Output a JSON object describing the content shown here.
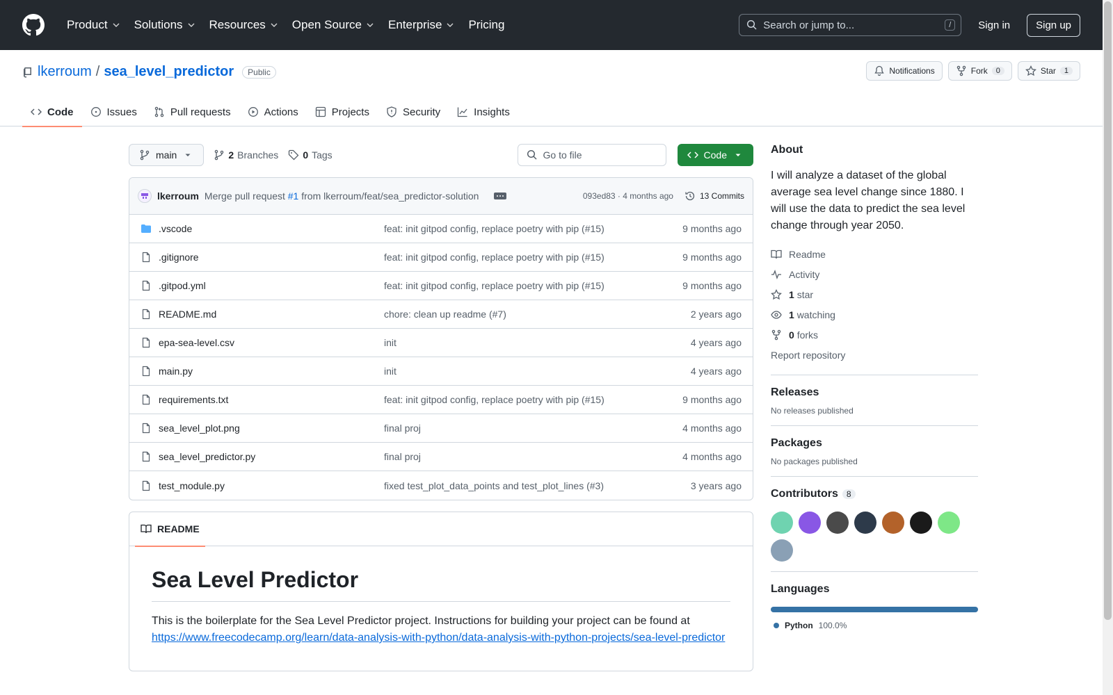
{
  "header": {
    "nav": [
      "Product",
      "Solutions",
      "Resources",
      "Open Source",
      "Enterprise",
      "Pricing"
    ],
    "search_placeholder": "Search or jump to...",
    "search_shortcut": "/",
    "sign_in": "Sign in",
    "sign_up": "Sign up"
  },
  "repo": {
    "owner": "lkerroum",
    "separator": "/",
    "name": "sea_level_predictor",
    "visibility": "Public",
    "notifications": "Notifications",
    "fork_label": "Fork",
    "fork_count": "0",
    "star_label": "Star",
    "star_count": "1",
    "tabs": [
      "Code",
      "Issues",
      "Pull requests",
      "Actions",
      "Projects",
      "Security",
      "Insights"
    ]
  },
  "toolbar": {
    "branch": "main",
    "branches_count": "2",
    "branches_label": "Branches",
    "tags_count": "0",
    "tags_label": "Tags",
    "goto_file": "Go to file",
    "code_button": "Code"
  },
  "commit": {
    "author": "lkerroum",
    "msg_prefix": "Merge pull request",
    "pr": "#1",
    "msg_suffix": "from lkerroum/feat/sea_predictor-solution",
    "hash_age": "093ed83 · 4 months ago",
    "commits_label": "13 Commits"
  },
  "files": [
    {
      "name": ".vscode",
      "type": "folder",
      "msg": "feat: init gitpod config, replace poetry with pip (#15)",
      "age": "9 months ago"
    },
    {
      "name": ".gitignore",
      "type": "file",
      "msg": "feat: init gitpod config, replace poetry with pip (#15)",
      "age": "9 months ago"
    },
    {
      "name": ".gitpod.yml",
      "type": "file",
      "msg": "feat: init gitpod config, replace poetry with pip (#15)",
      "age": "9 months ago"
    },
    {
      "name": "README.md",
      "type": "file",
      "msg": "chore: clean up readme (#7)",
      "age": "2 years ago"
    },
    {
      "name": "epa-sea-level.csv",
      "type": "file",
      "msg": "init",
      "age": "4 years ago"
    },
    {
      "name": "main.py",
      "type": "file",
      "msg": "init",
      "age": "4 years ago"
    },
    {
      "name": "requirements.txt",
      "type": "file",
      "msg": "feat: init gitpod config, replace poetry with pip (#15)",
      "age": "9 months ago"
    },
    {
      "name": "sea_level_plot.png",
      "type": "file",
      "msg": "final proj",
      "age": "4 months ago"
    },
    {
      "name": "sea_level_predictor.py",
      "type": "file",
      "msg": "final proj",
      "age": "4 months ago"
    },
    {
      "name": "test_module.py",
      "type": "file",
      "msg": "fixed test_plot_data_points and test_plot_lines (#3)",
      "age": "3 years ago"
    }
  ],
  "readme": {
    "tab": "README",
    "title": "Sea Level Predictor",
    "text": "This is the boilerplate for the Sea Level Predictor project. Instructions for building your project can be found at",
    "link": "https://www.freecodecamp.org/learn/data-analysis-with-python/data-analysis-with-python-projects/sea-level-predictor"
  },
  "about": {
    "title": "About",
    "description": "I will analyze a dataset of the global average sea level change since 1880. I will use the data to predict the sea level change through year 2050.",
    "readme": "Readme",
    "activity": "Activity",
    "stars_count": "1",
    "stars_label": "star",
    "watching_count": "1",
    "watching_label": "watching",
    "forks_count": "0",
    "forks_label": "forks",
    "report": "Report repository"
  },
  "releases": {
    "title": "Releases",
    "text": "No releases published"
  },
  "packages": {
    "title": "Packages",
    "text": "No packages published"
  },
  "contributors": {
    "title": "Contributors",
    "count": "8",
    "avatar_colors": [
      "#6fd3b0",
      "#8957e5",
      "#4a4a4a",
      "#2d3a4a",
      "#b3622a",
      "#1a1a1a",
      "#7ee787",
      "#8aa0b5"
    ]
  },
  "languages": {
    "title": "Languages",
    "items": [
      {
        "name": "Python",
        "percent": "100.0%",
        "color": "#3572A5"
      }
    ]
  }
}
